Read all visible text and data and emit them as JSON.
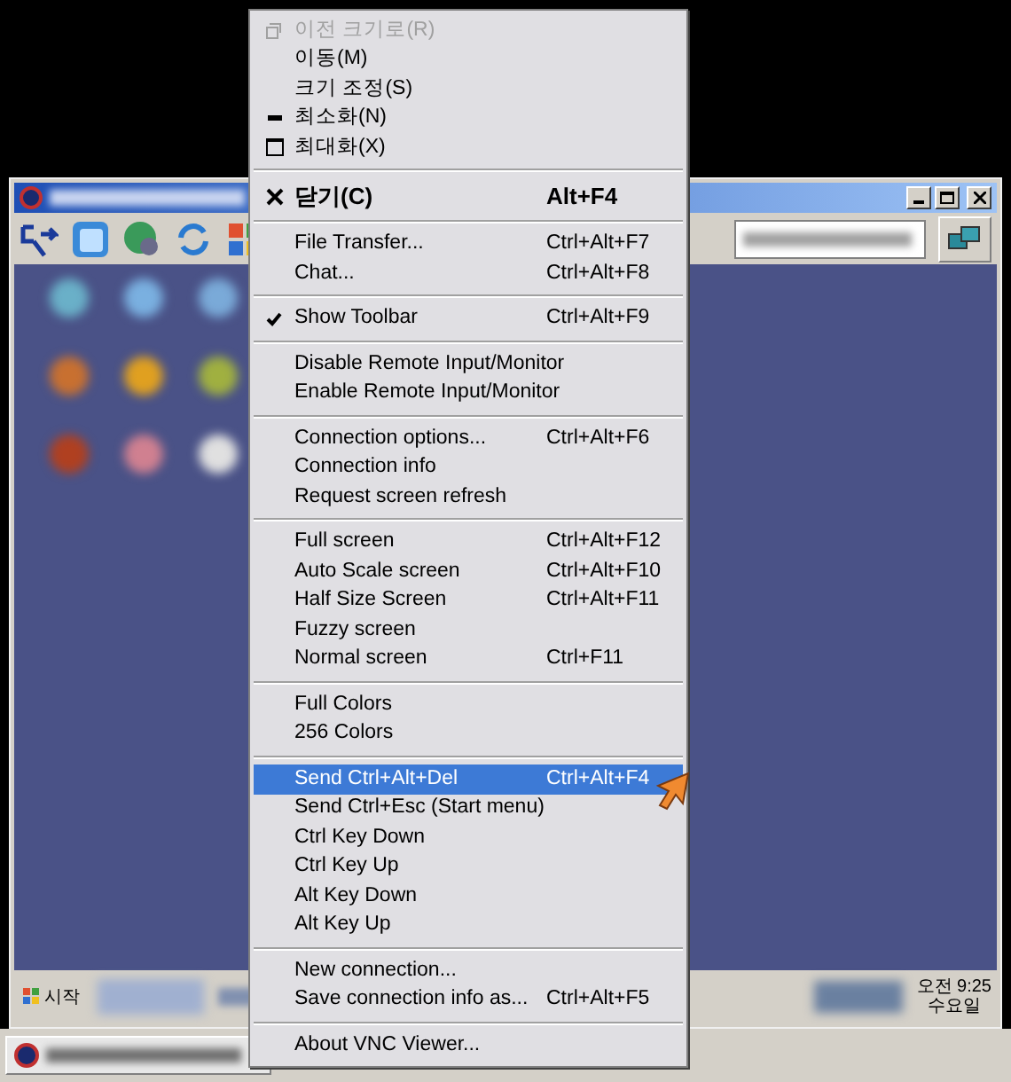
{
  "remote_taskbar": {
    "start_label": "시작",
    "clock_time": "오전 9:25",
    "clock_day": "수요일"
  },
  "menu": {
    "items": [
      {
        "kind": "restore",
        "label": "이전 크기로(R)",
        "disabled": true,
        "selected": false,
        "checked": false
      },
      {
        "kind": "item",
        "label": "이동(M)",
        "disabled": false,
        "selected": false,
        "checked": false
      },
      {
        "kind": "item",
        "label": "크기 조정(S)",
        "disabled": false,
        "selected": false,
        "checked": false
      },
      {
        "kind": "minimize",
        "label": "최소화(N)",
        "disabled": false,
        "selected": false,
        "checked": false
      },
      {
        "kind": "maximize",
        "label": "최대화(X)",
        "disabled": false,
        "selected": false,
        "checked": false
      },
      {
        "kind": "separator"
      },
      {
        "kind": "close",
        "label": "닫기(C)",
        "shortcut": "Alt+F4",
        "disabled": false,
        "selected": false,
        "checked": false
      },
      {
        "kind": "separator"
      },
      {
        "kind": "item",
        "label": "File Transfer...",
        "shortcut": "Ctrl+Alt+F7",
        "disabled": false,
        "selected": false,
        "checked": false
      },
      {
        "kind": "item",
        "label": "Chat...",
        "shortcut": "Ctrl+Alt+F8",
        "disabled": false,
        "selected": false,
        "checked": false
      },
      {
        "kind": "separator"
      },
      {
        "kind": "item",
        "label": "Show Toolbar",
        "shortcut": "Ctrl+Alt+F9",
        "disabled": false,
        "selected": false,
        "checked": true
      },
      {
        "kind": "separator"
      },
      {
        "kind": "item",
        "label": "Disable Remote Input/Monitor",
        "disabled": false,
        "selected": false,
        "checked": false
      },
      {
        "kind": "item",
        "label": "Enable Remote Input/Monitor",
        "disabled": false,
        "selected": false,
        "checked": false
      },
      {
        "kind": "separator"
      },
      {
        "kind": "item",
        "label": "Connection options...",
        "shortcut": "Ctrl+Alt+F6",
        "disabled": false,
        "selected": false,
        "checked": false
      },
      {
        "kind": "item",
        "label": "Connection info",
        "disabled": false,
        "selected": false,
        "checked": false
      },
      {
        "kind": "item",
        "label": "Request screen refresh",
        "disabled": false,
        "selected": false,
        "checked": false
      },
      {
        "kind": "separator"
      },
      {
        "kind": "item",
        "label": "Full screen",
        "shortcut": "Ctrl+Alt+F12",
        "disabled": false,
        "selected": false,
        "checked": false
      },
      {
        "kind": "item",
        "label": "Auto Scale screen",
        "shortcut": "Ctrl+Alt+F10",
        "disabled": false,
        "selected": false,
        "checked": false
      },
      {
        "kind": "item",
        "label": "Half Size Screen",
        "shortcut": "Ctrl+Alt+F11",
        "disabled": false,
        "selected": false,
        "checked": false
      },
      {
        "kind": "item",
        "label": "Fuzzy screen",
        "disabled": false,
        "selected": false,
        "checked": false
      },
      {
        "kind": "item",
        "label": "Normal screen",
        "shortcut": "Ctrl+F11",
        "disabled": false,
        "selected": false,
        "checked": false
      },
      {
        "kind": "separator"
      },
      {
        "kind": "item",
        "label": "Full Colors",
        "disabled": false,
        "selected": false,
        "checked": false
      },
      {
        "kind": "item",
        "label": "256  Colors",
        "disabled": false,
        "selected": false,
        "checked": false
      },
      {
        "kind": "separator"
      },
      {
        "kind": "item",
        "label": "Send Ctrl+Alt+Del",
        "shortcut": "Ctrl+Alt+F4",
        "disabled": false,
        "selected": true,
        "checked": false
      },
      {
        "kind": "item",
        "label": "Send Ctrl+Esc (Start menu)",
        "disabled": false,
        "selected": false,
        "checked": false
      },
      {
        "kind": "item",
        "label": "Ctrl Key Down",
        "disabled": false,
        "selected": false,
        "checked": false
      },
      {
        "kind": "item",
        "label": "Ctrl Key Up",
        "disabled": false,
        "selected": false,
        "checked": false
      },
      {
        "kind": "item",
        "label": "Alt Key Down",
        "disabled": false,
        "selected": false,
        "checked": false
      },
      {
        "kind": "item",
        "label": "Alt Key Up",
        "disabled": false,
        "selected": false,
        "checked": false
      },
      {
        "kind": "separator"
      },
      {
        "kind": "item",
        "label": "New connection...",
        "disabled": false,
        "selected": false,
        "checked": false
      },
      {
        "kind": "item",
        "label": "Save connection info as...",
        "shortcut": "Ctrl+Alt+F5",
        "disabled": false,
        "selected": false,
        "checked": false
      },
      {
        "kind": "separator"
      },
      {
        "kind": "item",
        "label": "About VNC Viewer...",
        "disabled": false,
        "selected": false,
        "checked": false
      }
    ]
  }
}
